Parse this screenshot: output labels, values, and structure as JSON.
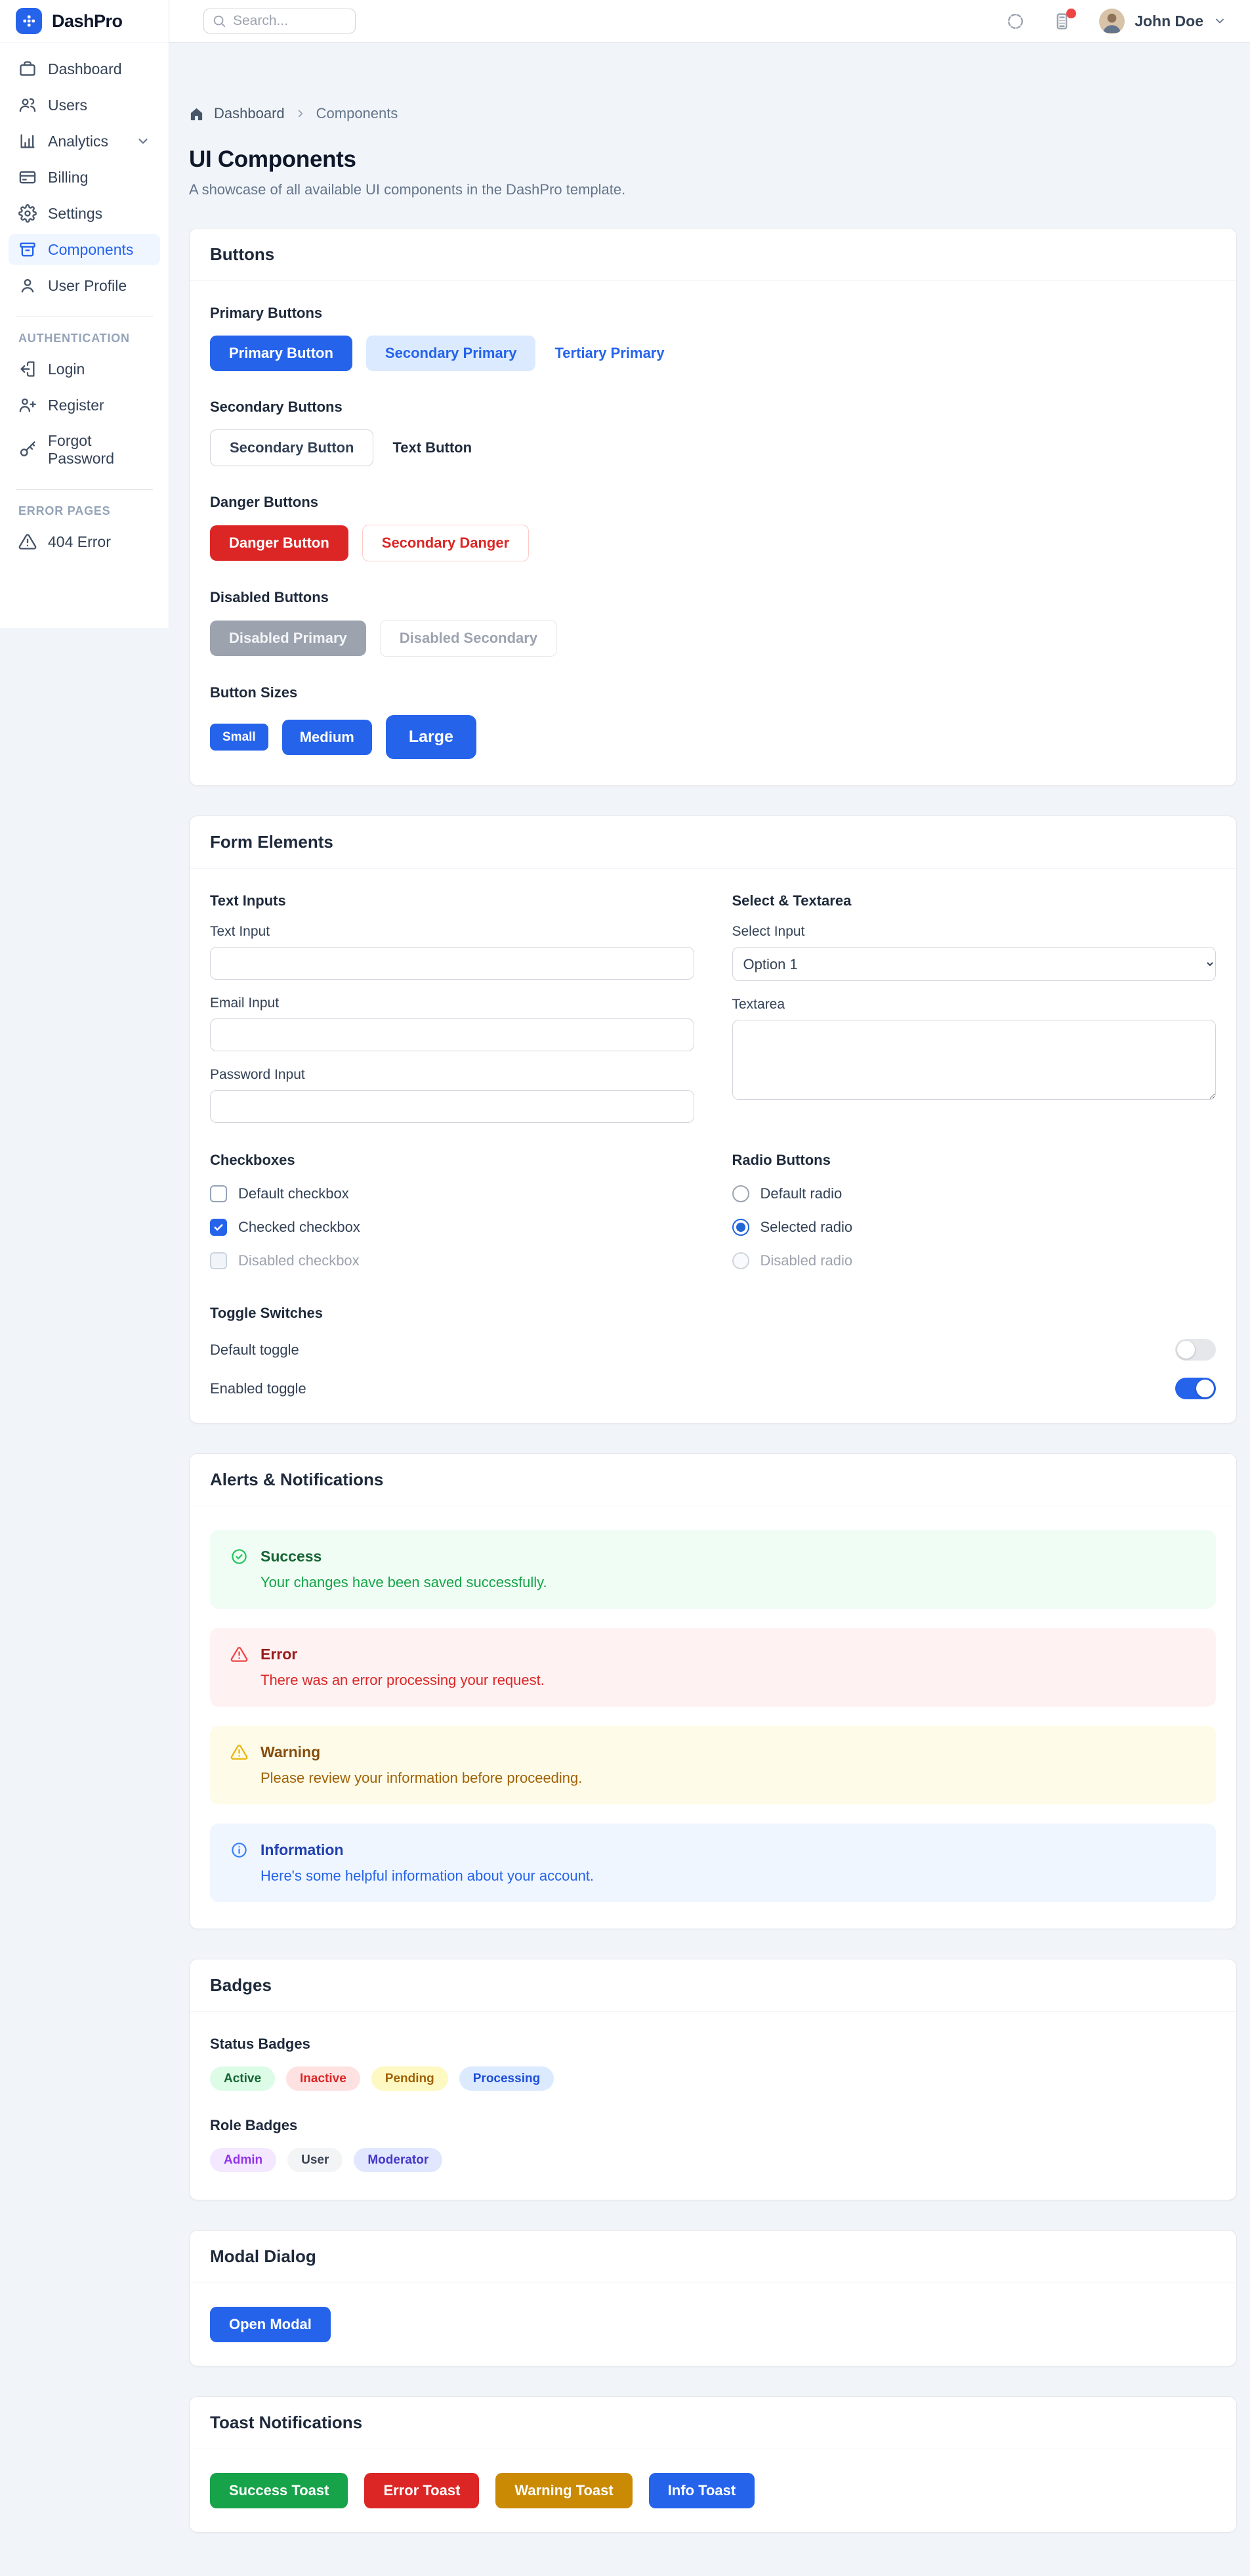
{
  "app": {
    "name": "DashPro"
  },
  "topbar": {
    "search_placeholder": "Search...",
    "user_name": "John Doe"
  },
  "sidebar": {
    "main": [
      {
        "label": "Dashboard"
      },
      {
        "label": "Users"
      },
      {
        "label": "Analytics"
      },
      {
        "label": "Billing"
      },
      {
        "label": "Settings"
      },
      {
        "label": "Components"
      },
      {
        "label": "User Profile"
      }
    ],
    "auth_section_label": "AUTHENTICATION",
    "auth": [
      {
        "label": "Login"
      },
      {
        "label": "Register"
      },
      {
        "label": "Forgot Password"
      }
    ],
    "error_section_label": "ERROR PAGES",
    "errors": [
      {
        "label": "404 Error"
      }
    ]
  },
  "breadcrumb": {
    "home": "Dashboard",
    "current": "Components"
  },
  "page": {
    "title": "UI Components",
    "subtitle": "A showcase of all available UI components in the DashPro template."
  },
  "buttons_card": {
    "title": "Buttons",
    "primary_label": "Primary Buttons",
    "primary": [
      "Primary Button",
      "Secondary Primary",
      "Tertiary Primary"
    ],
    "secondary_label": "Secondary Buttons",
    "secondary": [
      "Secondary Button",
      "Text Button"
    ],
    "danger_label": "Danger Buttons",
    "danger": [
      "Danger Button",
      "Secondary Danger"
    ],
    "disabled_label": "Disabled Buttons",
    "disabled": [
      "Disabled Primary",
      "Disabled Secondary"
    ],
    "sizes_label": "Button Sizes",
    "sizes": [
      "Small",
      "Medium",
      "Large"
    ]
  },
  "form_card": {
    "title": "Form Elements",
    "text_inputs_label": "Text Inputs",
    "text_label": "Text Input",
    "email_label": "Email Input",
    "password_label": "Password Input",
    "select_textarea_label": "Select & Textarea",
    "select_label": "Select Input",
    "select_value": "Option 1",
    "textarea_label": "Textarea",
    "checkboxes_label": "Checkboxes",
    "checkboxes": [
      "Default checkbox",
      "Checked checkbox",
      "Disabled checkbox"
    ],
    "radios_label": "Radio Buttons",
    "radios": [
      "Default radio",
      "Selected radio",
      "Disabled radio"
    ],
    "toggles_label": "Toggle Switches",
    "toggles": [
      "Default toggle",
      "Enabled toggle"
    ]
  },
  "alerts_card": {
    "title": "Alerts & Notifications",
    "alerts": [
      {
        "type": "success",
        "title": "Success",
        "message": "Your changes have been saved successfully."
      },
      {
        "type": "error",
        "title": "Error",
        "message": "There was an error processing your request."
      },
      {
        "type": "warning",
        "title": "Warning",
        "message": "Please review your information before proceeding."
      },
      {
        "type": "info",
        "title": "Information",
        "message": "Here's some helpful information about your account."
      }
    ]
  },
  "badges_card": {
    "title": "Badges",
    "status_label": "Status Badges",
    "status": [
      "Active",
      "Inactive",
      "Pending",
      "Processing"
    ],
    "role_label": "Role Badges",
    "roles": [
      "Admin",
      "User",
      "Moderator"
    ]
  },
  "modal_card": {
    "title": "Modal Dialog",
    "button": "Open Modal"
  },
  "toast_card": {
    "title": "Toast Notifications",
    "buttons": [
      "Success Toast",
      "Error Toast",
      "Warning Toast",
      "Info Toast"
    ]
  },
  "colors": {
    "primary": "#2563eb",
    "danger": "#dc2626",
    "success": "#16a34a",
    "warning": "#ca8a04",
    "sidebar_active_bg": "#eff6ff",
    "notification_dot": "#ef4444",
    "page_background": "#f1f5f9"
  }
}
